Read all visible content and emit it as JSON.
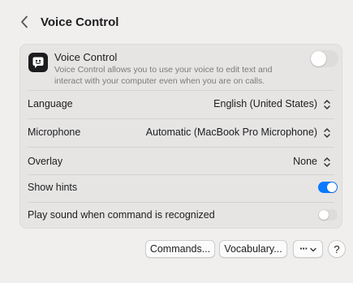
{
  "header": {
    "back_icon": "chevron-left-icon",
    "title": "Voice Control"
  },
  "voice_control": {
    "icon": "voice-control-app-icon",
    "title": "Voice Control",
    "description": "Voice Control allows you to use your voice to edit text and interact with your computer even when you are on calls.",
    "enabled": false
  },
  "settings": {
    "language": {
      "label": "Language",
      "value": "English (United States)"
    },
    "microphone": {
      "label": "Microphone",
      "value": "Automatic (MacBook Pro Microphone)"
    },
    "overlay": {
      "label": "Overlay",
      "value": "None"
    },
    "show_hints": {
      "label": "Show hints",
      "enabled": true
    },
    "play_sound": {
      "label": "Play sound when command is recognized",
      "enabled": false
    }
  },
  "footer": {
    "commands_label": "Commands...",
    "vocabulary_label": "Vocabulary...",
    "more_label": "···",
    "more_icon": "chevron-down-icon",
    "help_label": "?"
  },
  "colors": {
    "accent": "#0a7aff",
    "toggle_off": "#dddcdb",
    "background": "#f0efee",
    "card": "#e6e5e4"
  }
}
